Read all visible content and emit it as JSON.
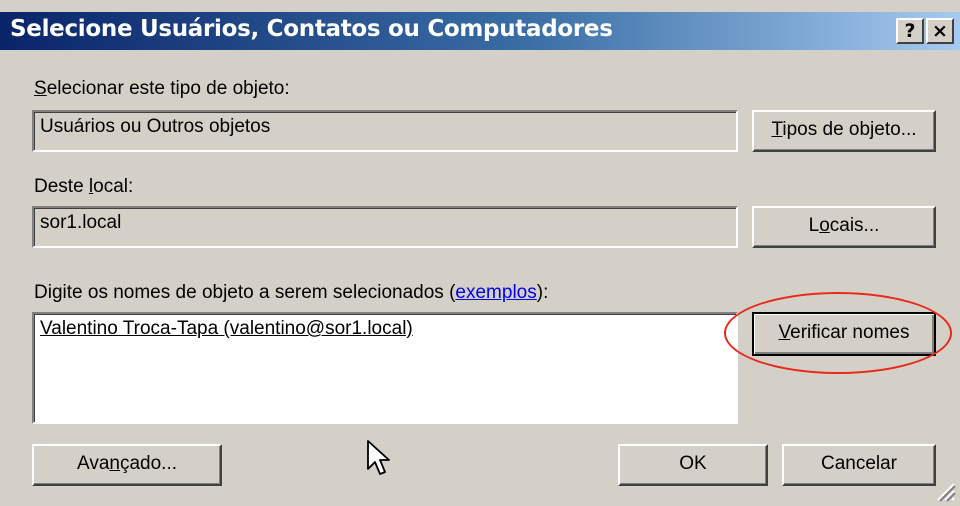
{
  "window": {
    "title": "Selecione Usuários, Contatos ou Computadores",
    "help_button": "?",
    "close_button": "×"
  },
  "object_type": {
    "label_mnemonic": "S",
    "label_rest": "elecionar este tipo de objeto:",
    "value": "Usuários ou Outros objetos",
    "button_mnemonic": "T",
    "button_rest": "ipos de objeto..."
  },
  "location": {
    "label_pre": "Deste ",
    "label_mnemonic": "l",
    "label_post": "ocal:",
    "value": "sor1.local",
    "button_pre": "L",
    "button_mnemonic": "o",
    "button_post": "cais..."
  },
  "names": {
    "label_pre": "Di",
    "label_mnemonic": "g",
    "label_mid": "ite os nomes de objeto a serem selecionados (",
    "examples_link": "exemplos",
    "label_post": "):",
    "entered_value": "Valentino Troca-Tapa (valentino@sor1.local)",
    "check_button_mnemonic": "V",
    "check_button_rest": "erificar nomes"
  },
  "footer": {
    "advanced_pre": "Ava",
    "advanced_mnemonic": "n",
    "advanced_post": "çado...",
    "ok_label": "OK",
    "cancel_label": "Cancelar"
  },
  "colors": {
    "title_bar_start": "#0a246a",
    "title_bar_end": "#a6caf0",
    "face": "#d4d0c8",
    "highlight_ellipse": "#e8281c",
    "link": "#0000ee"
  },
  "icons": [
    "help-icon",
    "close-icon",
    "mouse-pointer-icon",
    "resize-grip-icon"
  ]
}
